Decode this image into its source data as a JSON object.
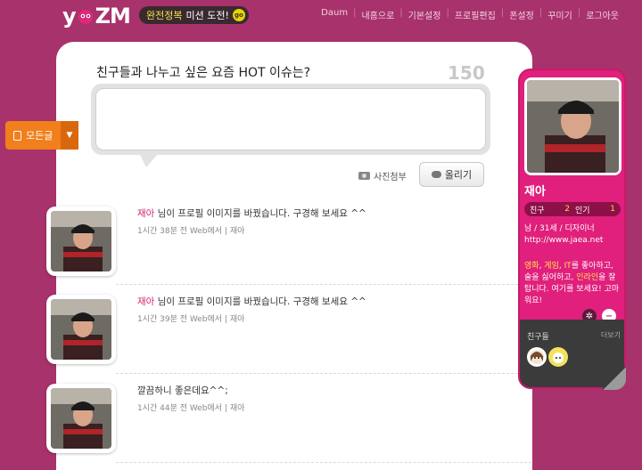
{
  "header": {
    "logo": "yozm",
    "mission": {
      "highlight": "완전정복",
      "text": "미션 도전!",
      "go": "go"
    },
    "nav": [
      "Daum",
      "내홈으로",
      "기본설정",
      "프로필편집",
      "폰설정",
      "꾸미기",
      "로그아웃"
    ]
  },
  "composer": {
    "question": "친구들과 나누고 싶은 요즘 HOT 이슈는?",
    "counter": "150",
    "photo_label": "사진첨부",
    "post_label": "올리기"
  },
  "sidebar_tab": {
    "label": "모든글"
  },
  "feed": [
    {
      "name": "재아",
      "text": "님이 프로필 이미지를 바꿨습니다. 구경해 보세요 ^^",
      "time": "1시간 38분 전 Web에서",
      "author": "재아"
    },
    {
      "name": "재아",
      "text": "님이 프로필 이미지를 바꿨습니다. 구경해 보세요 ^^",
      "time": "1시간 39분 전 Web에서",
      "author": "재아"
    },
    {
      "name": "",
      "text": "깔끔하니 좋은데요^^;",
      "time": "1시간 44분 전 Web에서",
      "author": "재아"
    }
  ],
  "profile": {
    "name": "재아",
    "friends_label": "친구",
    "friends_count": "2",
    "popular_label": "인기",
    "popular_count": "1",
    "info_line": "남 / 31세 / 디자이너",
    "url": "http://www.jaea.net",
    "bio": {
      "hl1": "영화",
      "sep1": ", ",
      "hl2": "게임",
      "sep2": ", ",
      "hl3": "IT",
      "mid": "를 좋아하고, 술을 싫어하고, ",
      "hl4": "인라인",
      "end": "을 잘 탑니다. 여기를 보세요! 고마워요!"
    },
    "friends_section": "친구들",
    "more_label": "더보기"
  },
  "colors": {
    "brand": "#a8326b",
    "accent": "#e0207c",
    "name_link": "#d0246f",
    "tab": "#f07f1c"
  }
}
